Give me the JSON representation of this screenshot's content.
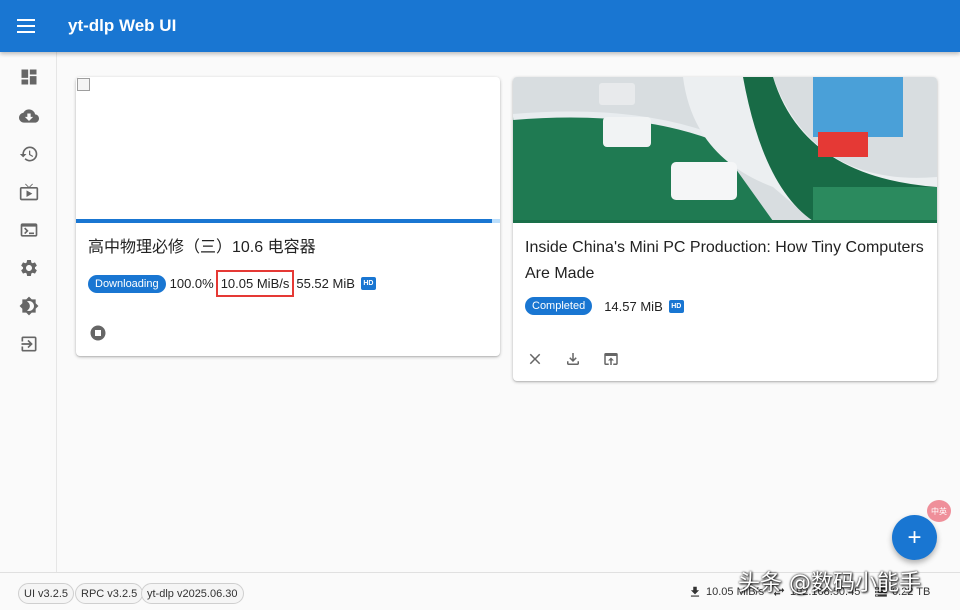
{
  "appbar": {
    "title": "yt-dlp Web UI",
    "menu_icon": "hamburger-icon"
  },
  "sidebar": {
    "items": [
      {
        "icon": "dashboard-icon"
      },
      {
        "icon": "cloud-download-icon"
      },
      {
        "icon": "history-icon"
      },
      {
        "icon": "live-tv-icon"
      },
      {
        "icon": "terminal-icon"
      },
      {
        "icon": "settings-icon"
      },
      {
        "icon": "theme-toggle-icon"
      },
      {
        "icon": "logout-icon"
      }
    ]
  },
  "downloads": [
    {
      "title": "高中物理必修（三）10.6 电容器",
      "status": "Downloading",
      "progress": "100.0%",
      "progress_fraction": 0.98,
      "speed": "10.05 MiB/s",
      "size": "55.52 MiB",
      "quality_badge": "HD"
    },
    {
      "title": "Inside China's Mini PC Production: How Tiny Computers Are Made",
      "status": "Completed",
      "size": "14.57 MiB",
      "quality_badge": "HD"
    }
  ],
  "footer": {
    "versions": [
      "UI v3.2.5",
      "RPC v3.2.5",
      "yt-dlp v2025.06.30"
    ],
    "download_speed": "10.05 MiB/s",
    "server": "192.168.50.45",
    "disk": "6.22 TB"
  },
  "fab": {
    "label": "+"
  },
  "overlay": {
    "badge": "中英",
    "watermark": "头条 @数码小能手"
  },
  "colors": {
    "primary": "#1976d2",
    "highlight_border": "#e53935"
  }
}
